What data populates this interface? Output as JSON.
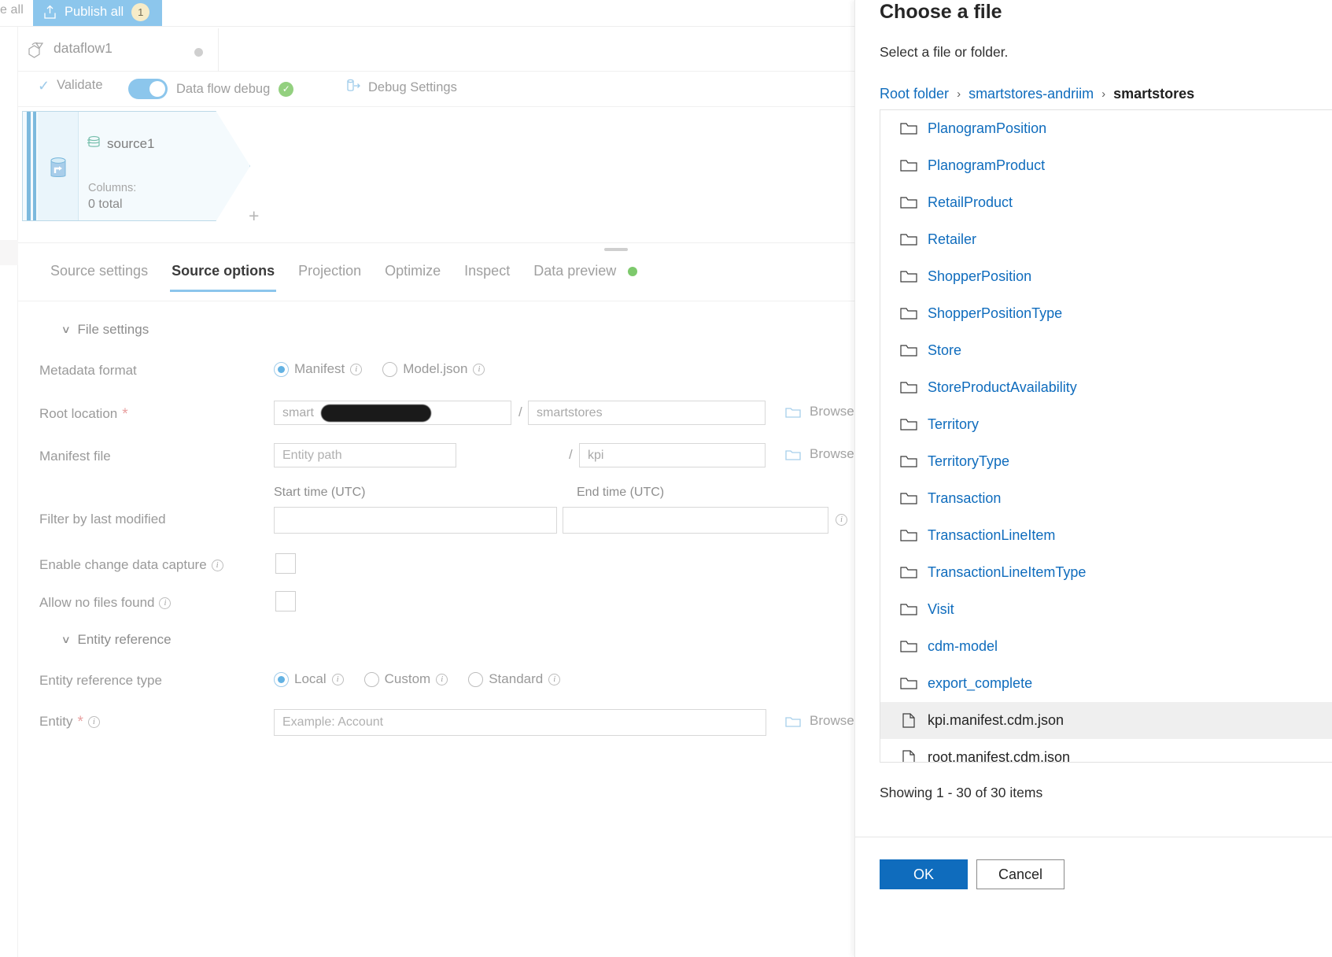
{
  "toolbar": {
    "left_cut_label": "e all",
    "publish_all_label": "Publish all",
    "publish_count": "1"
  },
  "dataflow": {
    "name": "dataflow1"
  },
  "debug_bar": {
    "validate_label": "Validate",
    "data_flow_debug_label": "Data flow debug",
    "debug_settings_label": "Debug Settings"
  },
  "canvas": {
    "node": {
      "title": "source1",
      "columns_label": "Columns:",
      "columns_value": "0 total",
      "add_label": "+"
    }
  },
  "tabs": [
    {
      "label": "Source settings",
      "active": false,
      "dot": false
    },
    {
      "label": "Source options",
      "active": true,
      "dot": false
    },
    {
      "label": "Projection",
      "active": false,
      "dot": false
    },
    {
      "label": "Optimize",
      "active": false,
      "dot": false
    },
    {
      "label": "Inspect",
      "active": false,
      "dot": false
    },
    {
      "label": "Data preview",
      "active": false,
      "dot": true
    }
  ],
  "form": {
    "file_settings_section": "File settings",
    "entity_reference_section": "Entity reference",
    "metadata_format": {
      "label": "Metadata format",
      "options": [
        {
          "label": "Manifest",
          "selected": true
        },
        {
          "label": "Model.json",
          "selected": false
        }
      ]
    },
    "root_location": {
      "label": "Root location",
      "required": true,
      "container_value": "smart",
      "container_redacted": true,
      "folder_value": "smartstores",
      "separator": "/",
      "browse_label": "Browse"
    },
    "manifest_file": {
      "label": "Manifest file",
      "entity_path_placeholder": "Entity path",
      "file_value": "kpi",
      "separator": "/",
      "browse_label": "Browse"
    },
    "filter_by_last_modified": {
      "label": "Filter by last modified",
      "start_time_label": "Start time (UTC)",
      "end_time_label": "End time (UTC)",
      "start_time_value": "",
      "end_time_value": ""
    },
    "enable_change_data_capture": {
      "label": "Enable change data capture",
      "checked": false
    },
    "allow_no_files_found": {
      "label": "Allow no files found",
      "checked": false
    },
    "entity_reference_type": {
      "label": "Entity reference type",
      "options": [
        {
          "label": "Local",
          "selected": true
        },
        {
          "label": "Custom",
          "selected": false
        },
        {
          "label": "Standard",
          "selected": false
        }
      ]
    },
    "entity": {
      "label": "Entity",
      "required": true,
      "placeholder": "Example: Account",
      "browse_label": "Browse"
    }
  },
  "file_panel": {
    "title": "Choose a file",
    "subtitle": "Select a file or folder.",
    "breadcrumb": [
      {
        "label": "Root folder",
        "current": false
      },
      {
        "label": "smartstores-andriim",
        "current": false
      },
      {
        "label": "smartstores",
        "current": true
      }
    ],
    "breadcrumb_separator": "›",
    "items": [
      {
        "name": "PlanogramPosition",
        "type": "folder",
        "selected": false
      },
      {
        "name": "PlanogramProduct",
        "type": "folder",
        "selected": false
      },
      {
        "name": "RetailProduct",
        "type": "folder",
        "selected": false
      },
      {
        "name": "Retailer",
        "type": "folder",
        "selected": false
      },
      {
        "name": "ShopperPosition",
        "type": "folder",
        "selected": false
      },
      {
        "name": "ShopperPositionType",
        "type": "folder",
        "selected": false
      },
      {
        "name": "Store",
        "type": "folder",
        "selected": false
      },
      {
        "name": "StoreProductAvailability",
        "type": "folder",
        "selected": false
      },
      {
        "name": "Territory",
        "type": "folder",
        "selected": false
      },
      {
        "name": "TerritoryType",
        "type": "folder",
        "selected": false
      },
      {
        "name": "Transaction",
        "type": "folder",
        "selected": false
      },
      {
        "name": "TransactionLineItem",
        "type": "folder",
        "selected": false
      },
      {
        "name": "TransactionLineItemType",
        "type": "folder",
        "selected": false
      },
      {
        "name": "Visit",
        "type": "folder",
        "selected": false
      },
      {
        "name": "cdm-model",
        "type": "folder",
        "selected": false
      },
      {
        "name": "export_complete",
        "type": "folder",
        "selected": false
      },
      {
        "name": "kpi.manifest.cdm.json",
        "type": "file",
        "selected": true
      },
      {
        "name": "root.manifest.cdm.json",
        "type": "file",
        "selected": false
      }
    ],
    "showing_text": "Showing 1 - 30 of 30 items",
    "ok_label": "OK",
    "cancel_label": "Cancel"
  },
  "colors": {
    "accent_blue": "#0f6cbd",
    "toolbar_blue": "#8cc6ec",
    "link_blue": "#0f6cbd",
    "status_green": "#7dc96c",
    "badge_yellow": "#f7ecc8",
    "required_red": "#e8a0a0"
  }
}
